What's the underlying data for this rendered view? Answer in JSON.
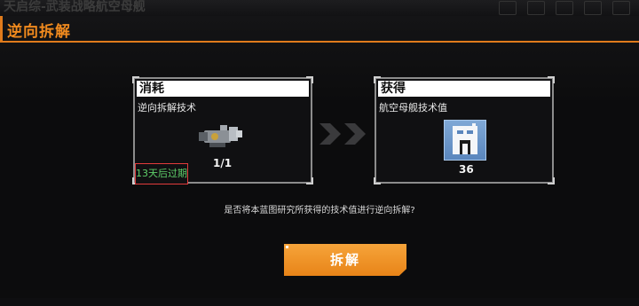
{
  "background": {
    "title": "天启综-武装战略航空母舰"
  },
  "dialog": {
    "title": "逆向拆解",
    "consume": {
      "header": "消耗",
      "subtitle": "逆向拆解技术",
      "count": "1/1",
      "expire": "13天后过期",
      "icon": "mechanical-part-icon"
    },
    "obtain": {
      "header": "获得",
      "subtitle": "航空母舰技术值",
      "value": "36",
      "icon": "blueprint-building-icon"
    },
    "question": "是否将本蓝图研究所获得的技术值进行逆向拆解?",
    "button": "拆解"
  },
  "colors": {
    "accent": "#e07b1c",
    "button": "#f09a2a",
    "expire_text": "#5fd06a",
    "expire_border": "#e23b3b"
  }
}
